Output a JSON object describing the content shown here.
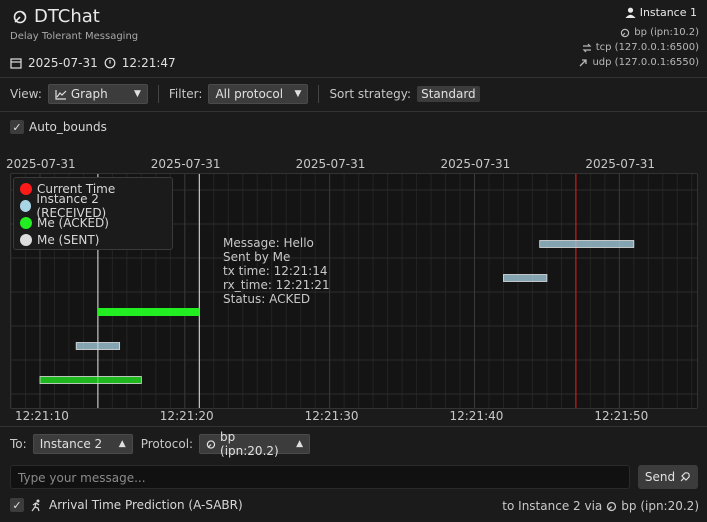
{
  "app": {
    "title": "DTChat",
    "subtitle": "Delay Tolerant Messaging"
  },
  "datetime": {
    "date": "2025-07-31",
    "time": "12:21:47"
  },
  "instance": {
    "label": "Instance 1"
  },
  "endpoints": [
    {
      "icon": "bp-icon",
      "text": "bp (ipn:10.2)"
    },
    {
      "icon": "tcp-icon",
      "text": "tcp (127.0.0.1:6500)"
    },
    {
      "icon": "udp-icon",
      "text": "udp (127.0.0.1:6550)"
    }
  ],
  "toolbar": {
    "view_label": "View:",
    "view_value": "Graph",
    "filter_label": "Filter:",
    "filter_value": "All protocol",
    "sort_label": "Sort strategy:",
    "sort_value": "Standard"
  },
  "auto_bounds": {
    "label": "Auto_bounds",
    "checked": true
  },
  "chart_data": {
    "type": "gantt",
    "top_axis_labels": [
      "2025-07-31",
      "2025-07-31",
      "2025-07-31",
      "2025-07-31",
      "2025-07-31"
    ],
    "bottom_axis_labels": [
      "12:21:10",
      "12:21:20",
      "12:21:30",
      "12:21:40",
      "12:21:50"
    ],
    "x_ticks_seconds": [
      10,
      20,
      30,
      40,
      50
    ],
    "x_range_seconds": [
      8.0,
      55.5
    ],
    "current_time_seconds": 47.0,
    "legend": [
      {
        "name": "Current Time",
        "color": "#ff1a1a"
      },
      {
        "name": "Instance 2 (RECEIVED)",
        "color": "#a9d4e6"
      },
      {
        "name": "Me (ACKED)",
        "color": "#22ee22"
      },
      {
        "name": "Me (SENT)",
        "color": "#dddddd"
      }
    ],
    "bars": [
      {
        "series": "Me (ACKED)",
        "tx": 10.0,
        "rx": 17.0,
        "row": 0,
        "color": "#22ee22",
        "selected": false
      },
      {
        "series": "Instance 2 (RECEIVED)",
        "tx": 12.5,
        "rx": 15.5,
        "row": 1,
        "color": "#a9d4e6",
        "selected": false
      },
      {
        "series": "Me (ACKED)",
        "tx": 14.0,
        "rx": 21.0,
        "row": 2,
        "color": "#22ee22",
        "selected": true
      },
      {
        "series": "Instance 2 (RECEIVED)",
        "tx": 42.0,
        "rx": 45.0,
        "row": 3,
        "color": "#a9d4e6",
        "selected": false
      },
      {
        "series": "Instance 2 (RECEIVED)",
        "tx": 44.5,
        "rx": 51.0,
        "row": 4,
        "color": "#a9d4e6",
        "selected": false
      }
    ],
    "highlight_lines_seconds": [
      14.0,
      21.0
    ],
    "tooltip": {
      "message": "Message: Hello",
      "sender": "Sent by Me",
      "tx_time": "tx time: 12:21:14",
      "rx_time": "rx_time: 12:21:21",
      "status": "Status: ACKED"
    }
  },
  "compose": {
    "to_label": "To:",
    "to_value": "Instance 2",
    "protocol_label": "Protocol:",
    "protocol_value": "bp (ipn:20.2)",
    "placeholder": "Type your message...",
    "send_label": "Send"
  },
  "footer": {
    "prediction_label": "Arrival Time Prediction (A-SABR)",
    "prediction_checked": true,
    "route_prefix": "to Instance 2 via",
    "route_target": "bp (ipn:20.2)"
  }
}
